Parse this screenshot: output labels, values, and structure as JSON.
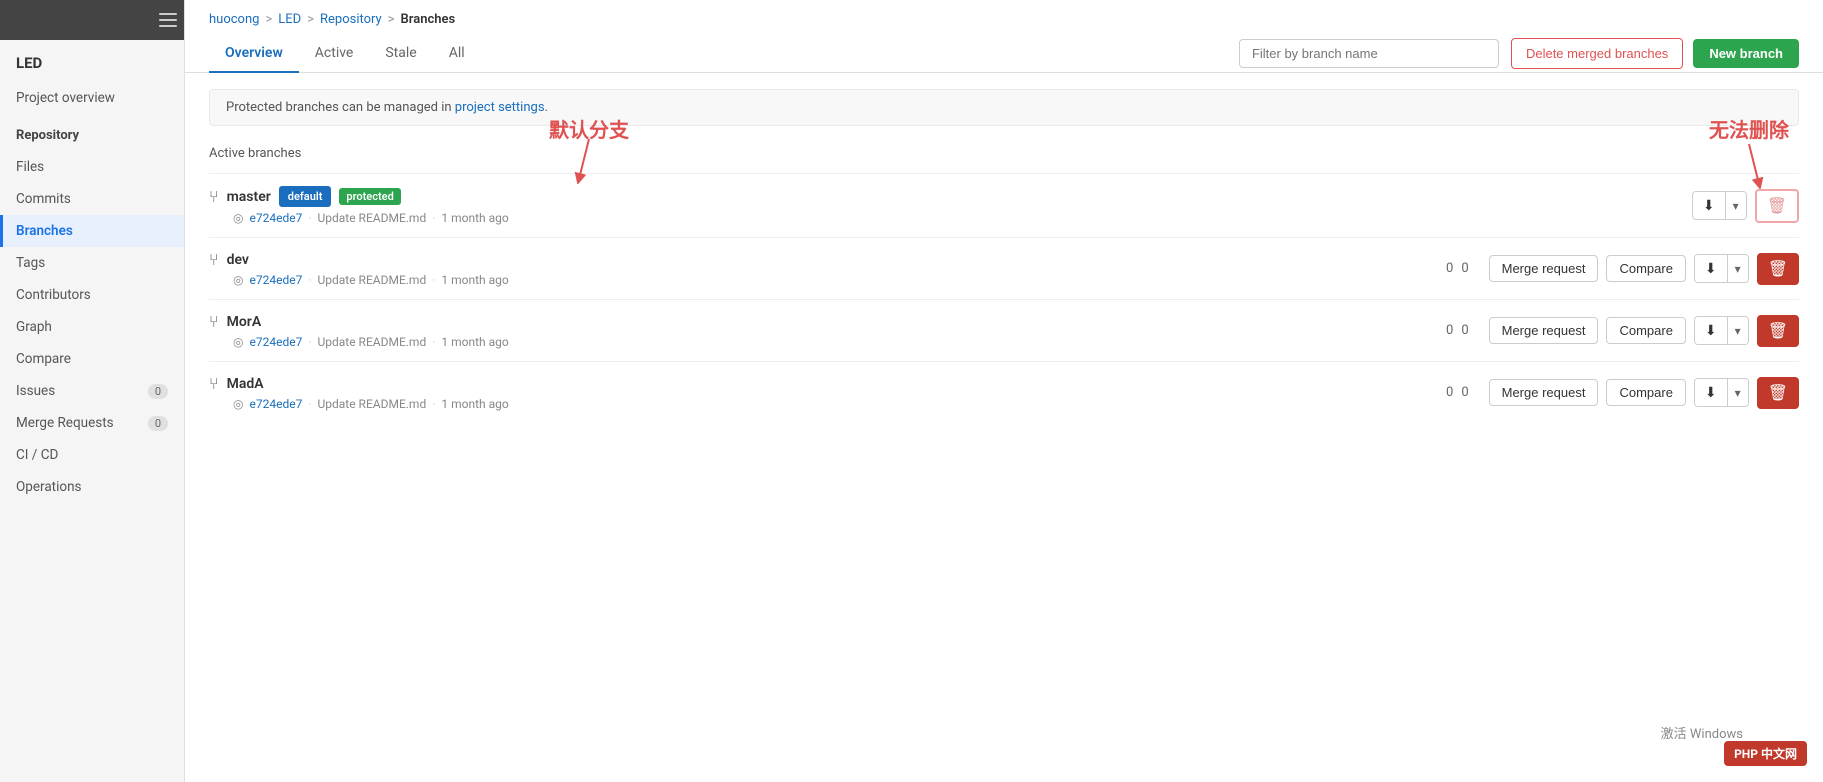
{
  "sidebar": {
    "project_title": "LED",
    "toggle_label": "toggle sidebar",
    "items": [
      {
        "id": "project-overview",
        "label": "Project overview",
        "active": false,
        "badge": null
      },
      {
        "id": "repository-header",
        "label": "Repository",
        "active": false,
        "badge": null,
        "isHeader": true
      },
      {
        "id": "files",
        "label": "Files",
        "active": false,
        "badge": null
      },
      {
        "id": "commits",
        "label": "Commits",
        "active": false,
        "badge": null
      },
      {
        "id": "branches",
        "label": "Branches",
        "active": true,
        "badge": null
      },
      {
        "id": "tags",
        "label": "Tags",
        "active": false,
        "badge": null
      },
      {
        "id": "contributors",
        "label": "Contributors",
        "active": false,
        "badge": null
      },
      {
        "id": "graph",
        "label": "Graph",
        "active": false,
        "badge": null
      },
      {
        "id": "compare",
        "label": "Compare",
        "active": false,
        "badge": null
      },
      {
        "id": "issues",
        "label": "Issues",
        "active": false,
        "badge": "0"
      },
      {
        "id": "merge-requests",
        "label": "Merge Requests",
        "active": false,
        "badge": "0"
      },
      {
        "id": "ci-cd",
        "label": "CI / CD",
        "active": false,
        "badge": null
      },
      {
        "id": "operations",
        "label": "Operations",
        "active": false,
        "badge": null
      }
    ]
  },
  "breadcrumb": {
    "parts": [
      {
        "text": "huocong",
        "link": true
      },
      {
        "text": ">",
        "link": false
      },
      {
        "text": "LED",
        "link": true
      },
      {
        "text": ">",
        "link": false
      },
      {
        "text": "Repository",
        "link": true
      },
      {
        "text": ">",
        "link": false
      },
      {
        "text": "Branches",
        "link": false,
        "current": true
      }
    ]
  },
  "tabs": [
    {
      "id": "overview",
      "label": "Overview",
      "active": true
    },
    {
      "id": "active",
      "label": "Active",
      "active": false
    },
    {
      "id": "stale",
      "label": "Stale",
      "active": false
    },
    {
      "id": "all",
      "label": "All",
      "active": false
    }
  ],
  "filter": {
    "placeholder": "Filter by branch name"
  },
  "buttons": {
    "delete_merged": "Delete merged branches",
    "new_branch": "New branch"
  },
  "info_bar": {
    "text": "Protected branches can be managed in",
    "link_text": "project settings",
    "period": "."
  },
  "section": {
    "title": "Active branches"
  },
  "annotations": {
    "default_label": "默认分支",
    "no_delete_label": "无法删除"
  },
  "branches": [
    {
      "id": "master",
      "name": "master",
      "badges": [
        "default",
        "protected"
      ],
      "commit_hash": "e724ede7",
      "commit_message": "Update README.md",
      "time_ago": "1 month ago",
      "stats": null,
      "actions": [
        "download"
      ],
      "delete_disabled": true
    },
    {
      "id": "dev",
      "name": "dev",
      "badges": [],
      "commit_hash": "e724ede7",
      "commit_message": "Update README.md",
      "time_ago": "1 month ago",
      "stats": {
        "ahead": "0",
        "behind": "0"
      },
      "actions": [
        "merge_request",
        "compare",
        "download"
      ],
      "delete_disabled": false
    },
    {
      "id": "MorA",
      "name": "MorA",
      "badges": [],
      "commit_hash": "e724ede7",
      "commit_message": "Update README.md",
      "time_ago": "1 month ago",
      "stats": {
        "ahead": "0",
        "behind": "0"
      },
      "actions": [
        "merge_request",
        "compare",
        "download"
      ],
      "delete_disabled": false
    },
    {
      "id": "MadA",
      "name": "MadA",
      "badges": [],
      "commit_hash": "e724ede7",
      "commit_message": "Update README.md",
      "time_ago": "1 month ago",
      "stats": {
        "ahead": "0",
        "behind": "0"
      },
      "actions": [
        "merge_request",
        "compare",
        "download"
      ],
      "delete_disabled": false
    }
  ],
  "watermark": "PHP 中文网",
  "windows_activate": "激活 Windows"
}
